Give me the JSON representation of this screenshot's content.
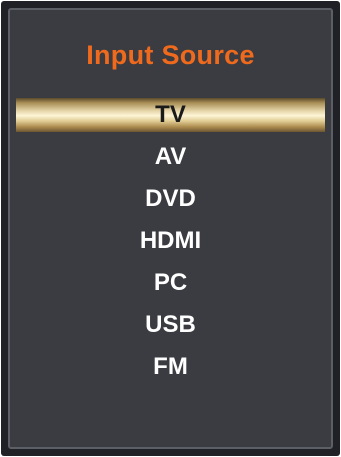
{
  "menu": {
    "title": "Input Source",
    "selected_index": 0,
    "items": [
      {
        "label": "TV"
      },
      {
        "label": "AV"
      },
      {
        "label": "DVD"
      },
      {
        "label": "HDMI"
      },
      {
        "label": "PC"
      },
      {
        "label": "USB"
      },
      {
        "label": "FM"
      }
    ]
  },
  "colors": {
    "title": "#f06a1e",
    "background": "#3a3c41",
    "highlight": "#e6d6ab"
  }
}
